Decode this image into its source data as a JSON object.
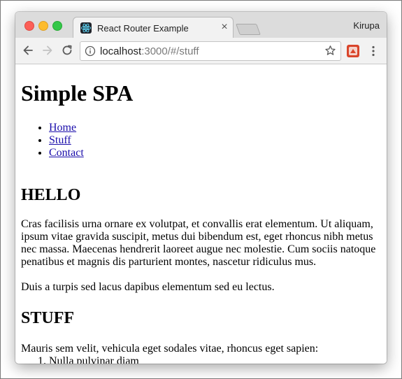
{
  "browser": {
    "tab_title": "React Router Example",
    "tab_close_glyph": "×",
    "profile_name": "Kirupa",
    "url_host": "localhost",
    "url_rest": ":3000/#/stuff",
    "colors": {
      "close": "#fc5f57",
      "minimize": "#fdbc2e",
      "maximize": "#33c748",
      "link": "#1a0dab"
    }
  },
  "page": {
    "title": "Simple SPA",
    "nav": [
      "Home",
      "Stuff",
      "Contact"
    ],
    "sections": [
      {
        "heading": "HELLO",
        "paragraphs": [
          "Cras facilisis urna ornare ex volutpat, et convallis erat elementum. Ut aliquam, ipsum vitae gravida suscipit, metus dui bibendum est, eget rhoncus nibh metus nec massa. Maecenas hendrerit laoreet augue nec molestie. Cum sociis natoque penatibus et magnis dis parturient montes, nascetur ridiculus mus.",
          "Duis a turpis sed lacus dapibus elementum sed eu lectus."
        ]
      },
      {
        "heading": "STUFF",
        "paragraphs": [
          "Mauris sem velit, vehicula eget sodales vitae, rhoncus eget sapien:"
        ],
        "list": [
          "Nulla pulvinar diam"
        ]
      }
    ]
  },
  "icons": {
    "back": "back-arrow-icon",
    "forward": "forward-arrow-icon",
    "reload": "reload-icon",
    "info": "info-icon",
    "bookmark": "star-icon",
    "extension": "extension-icon",
    "menu": "more-vert-icon",
    "favicon": "react-logo-icon"
  }
}
